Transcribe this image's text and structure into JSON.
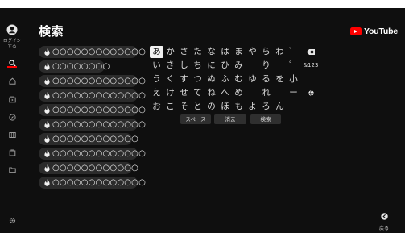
{
  "page": {
    "title": "検索",
    "brand": "YouTube"
  },
  "sidebar": {
    "login_label": "ログイン\nする",
    "items": [
      {
        "name": "search-icon",
        "active": true
      },
      {
        "name": "home-icon",
        "active": false
      },
      {
        "name": "subscriptions-icon",
        "active": false
      },
      {
        "name": "explore-icon",
        "active": false
      },
      {
        "name": "video-grid-icon",
        "active": false
      },
      {
        "name": "library-icon",
        "active": false
      },
      {
        "name": "folder-icon",
        "active": false
      }
    ],
    "settings_icon": "gear-icon"
  },
  "suggestions": [
    "○○○○○○○○○○○○○",
    "○○○○○○○○",
    "○○○○○○○○○○○○○",
    "○○○○○○○○○○○○○",
    "○○○○○○○○○○○○○",
    "○○○○○○○○○○○○○",
    "○○○○○○○○○○○○",
    "○○○○○○○○○○○○○",
    "○○○○○○○○○○○○",
    "○○○○○○○○○○○○○"
  ],
  "keyboard": {
    "rows": [
      [
        "あ",
        "か",
        "さ",
        "た",
        "な",
        "は",
        "ま",
        "や",
        "ら",
        "わ",
        "゛"
      ],
      [
        "い",
        "き",
        "し",
        "ち",
        "に",
        "ひ",
        "み",
        "",
        "り",
        "",
        "゜"
      ],
      [
        "う",
        "く",
        "す",
        "つ",
        "ぬ",
        "ふ",
        "む",
        "ゆ",
        "る",
        "を",
        "小"
      ],
      [
        "え",
        "け",
        "せ",
        "て",
        "ね",
        "へ",
        "め",
        "",
        "れ",
        "",
        "ー"
      ],
      [
        "お",
        "こ",
        "そ",
        "と",
        "の",
        "ほ",
        "も",
        "よ",
        "ろ",
        "ん",
        ""
      ]
    ],
    "selected": "あ",
    "side_keys": {
      "backspace_icon": "backspace-icon",
      "symbols": "&123",
      "voice_icon": "globe-icon"
    },
    "function_keys": {
      "space": "スペース",
      "clear": "消去",
      "search": "検索"
    }
  },
  "back": {
    "label": "戻る",
    "icon": "back-icon"
  },
  "colors": {
    "background": "#0f0f0f",
    "accent": "#ff0000",
    "chip": "#2b2b2b"
  }
}
